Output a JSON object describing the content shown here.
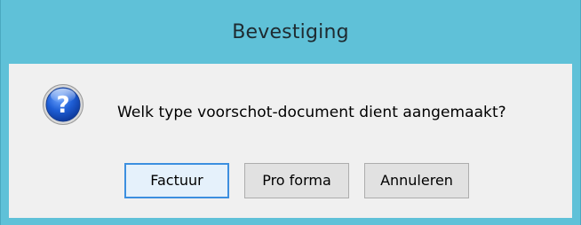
{
  "dialog": {
    "title": "Bevestiging",
    "icon": "question-icon",
    "message": "Welk type voorschot-document dient aangemaakt?",
    "buttons": {
      "factuur": "Factuur",
      "pro_forma": "Pro forma",
      "annuleren": "Annuleren"
    },
    "colors": {
      "titlebar": "#5fc1d8",
      "client_area": "#f0f0f0",
      "default_button_border": "#3c8fdf"
    }
  }
}
